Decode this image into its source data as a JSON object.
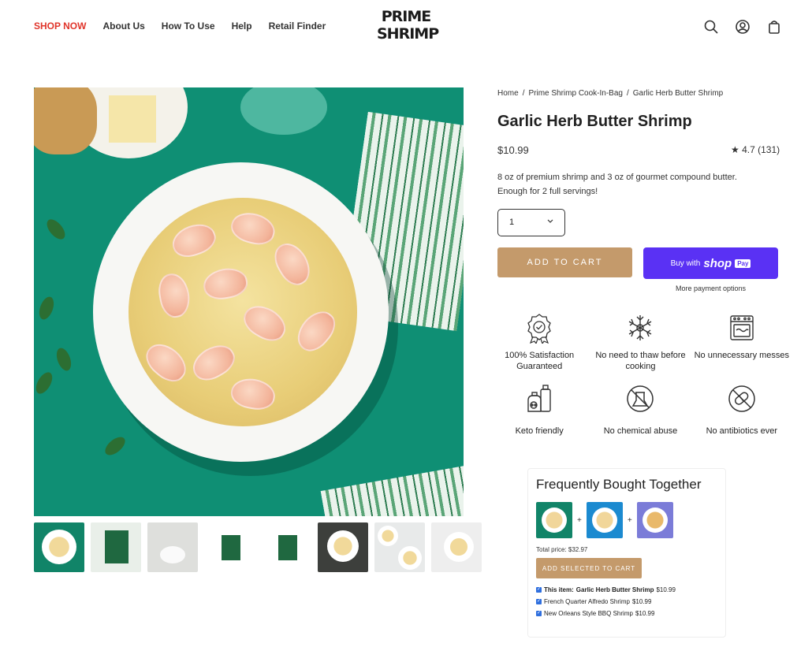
{
  "header": {
    "nav": [
      "SHOP NOW",
      "About Us",
      "How To Use",
      "Help",
      "Retail Finder"
    ],
    "logo_line1": "PRIME",
    "logo_line2": "SHRIMP",
    "icons": [
      "search-icon",
      "account-icon",
      "bag-icon"
    ]
  },
  "breadcrumb": [
    "Home",
    "Prime Shrimp Cook-In-Bag",
    "Garlic Herb Butter Shrimp"
  ],
  "product": {
    "title": "Garlic Herb Butter Shrimp",
    "price": "$10.99",
    "rating": "4.7",
    "review_count": "(131)",
    "description": "8 oz of premium shrimp and 3 oz of gourmet compound butter. Enough for 2 full servings!",
    "quantity": "1",
    "add_to_cart": "ADD TO CART",
    "buy_with": "Buy with",
    "shop": "shop",
    "pay": "Pay",
    "more_payment": "More payment options"
  },
  "features": [
    {
      "icon": "ribbon-badge-icon",
      "label": "100% Satisfaction Guaranteed"
    },
    {
      "icon": "snowflake-icon",
      "label": "No need to thaw before cooking"
    },
    {
      "icon": "oven-icon",
      "label": "No unnecessary messes"
    },
    {
      "icon": "bottles-icon",
      "label": "Keto friendly"
    },
    {
      "icon": "no-chemical-icon",
      "label": "No chemical abuse"
    },
    {
      "icon": "no-antibiotics-icon",
      "label": "No antibiotics ever"
    }
  ],
  "fbt": {
    "title": "Frequently Bought Together",
    "total": "Total price: $32.97",
    "button": "ADD SELECTED TO CART",
    "items": [
      {
        "prefix": "This item:",
        "name": "Garlic Herb Butter Shrimp",
        "price": "$10.99"
      },
      {
        "prefix": "",
        "name": "French Quarter Alfredo Shrimp",
        "price": "$10.99"
      },
      {
        "prefix": "",
        "name": "New Orleans Style BBQ Shrimp",
        "price": "$10.99"
      }
    ]
  },
  "colors": {
    "accent_red": "#e0352b",
    "cart_button": "#c49a6b",
    "shop_pay": "#5a31f4",
    "hero_bg": "#0f8f74"
  }
}
